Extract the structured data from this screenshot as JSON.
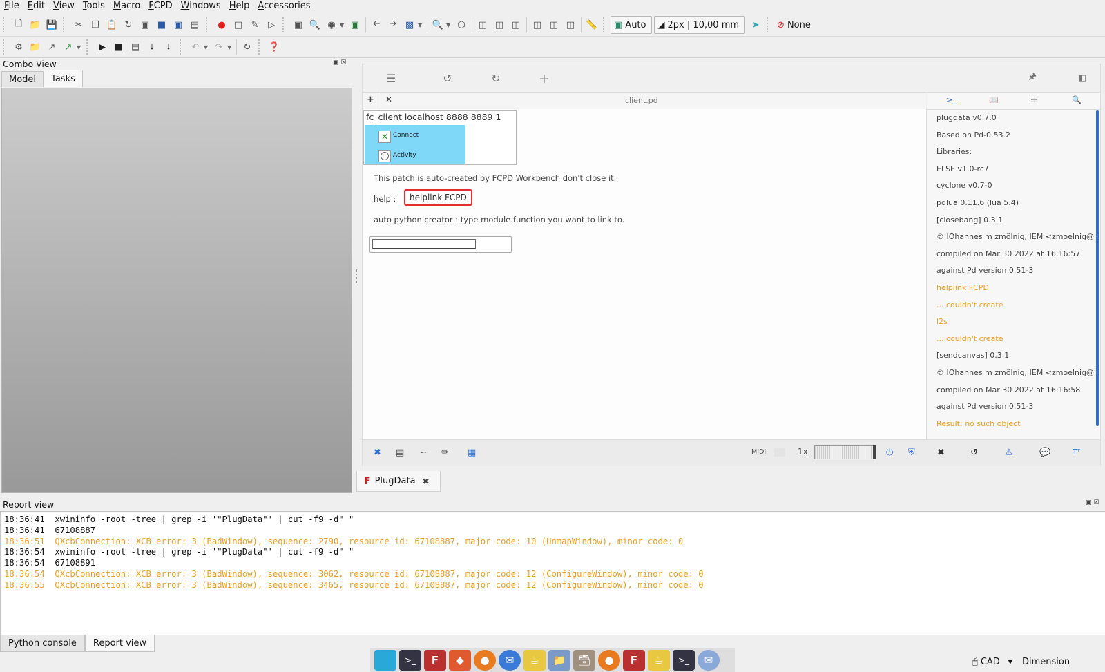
{
  "menubar": [
    "File",
    "Edit",
    "View",
    "Tools",
    "Macro",
    "FCPD",
    "Windows",
    "Help",
    "Accessories"
  ],
  "toolbar": {
    "draw_style_label": "Auto",
    "line_width_label": "2px | 10,00 mm",
    "snap_label": "None"
  },
  "combo_view": {
    "title": "Combo View",
    "tabs": [
      "Model",
      "Tasks"
    ],
    "active_tab": "Tasks"
  },
  "plugdata": {
    "canvas_tab": "client.pd",
    "fc_client_box": "fc_client localhost 8888 8889 1",
    "connect_label": "Connect",
    "activity_label": "Activity",
    "comment_auto": "This patch is auto-created by FCPD Workbench don't close it.",
    "help_label": "help :",
    "helplink_box": "helplink FCPD",
    "comment_python": "auto python creator : type module.function you want to link to.",
    "console_lines": [
      {
        "text": "plugdata v0.7.0",
        "warn": false
      },
      {
        "text": "Based on Pd-0.53.2",
        "warn": false
      },
      {
        "text": "Libraries:",
        "warn": false
      },
      {
        "text": "ELSE v1.0-rc7",
        "warn": false
      },
      {
        "text": "cyclone v0.7-0",
        "warn": false
      },
      {
        "text": "pdlua 0.11.6 (lua 5.4)",
        "warn": false
      },
      {
        "text": "[closebang] 0.3.1",
        "warn": false
      },
      {
        "text": "© IOhannes m zmölnig, IEM <zmoelnig@iem....",
        "warn": false
      },
      {
        "text": "compiled on Mar 30 2022 at 16:16:57",
        "warn": false
      },
      {
        "text": "against Pd version 0.51-3",
        "warn": false
      },
      {
        "text": "helplink FCPD",
        "warn": true
      },
      {
        "text": "... couldn't create",
        "warn": true
      },
      {
        "text": "l2s",
        "warn": true
      },
      {
        "text": "... couldn't create",
        "warn": true
      },
      {
        "text": "[sendcanvas] 0.3.1",
        "warn": false
      },
      {
        "text": "© IOhannes m zmölnig, IEM <zmoelnig@iem....",
        "warn": false
      },
      {
        "text": "compiled on Mar 30 2022 at 16:16:58",
        "warn": false
      },
      {
        "text": "against Pd version 0.51-3",
        "warn": false
      },
      {
        "text": "Result: no such object",
        "warn": true
      }
    ],
    "midi_label": "MIDI",
    "zoom_label": "1x",
    "window_tab": "PlugData"
  },
  "report_view": {
    "title": "Report view",
    "lines": [
      {
        "time": "18:36:41",
        "text": "xwininfo -root -tree | grep -i '\"PlugData\"' | cut -f9 -d\" \"",
        "warn": false
      },
      {
        "time": "18:36:41",
        "text": "67108887",
        "warn": false
      },
      {
        "time": "18:36:51",
        "text": "QXcbConnection: XCB error: 3 (BadWindow), sequence: 2790, resource id: 67108887, major code: 10 (UnmapWindow), minor code: 0",
        "warn": true
      },
      {
        "time": "18:36:54",
        "text": "xwininfo -root -tree | grep -i '\"PlugData\"' | cut -f9 -d\" \"",
        "warn": false
      },
      {
        "time": "18:36:54",
        "text": "67108891",
        "warn": false
      },
      {
        "time": "18:36:54",
        "text": "QXcbConnection: XCB error: 3 (BadWindow), sequence: 3062, resource id: 67108887, major code: 12 (ConfigureWindow), minor code: 0",
        "warn": true
      },
      {
        "time": "18:36:55",
        "text": "QXcbConnection: XCB error: 3 (BadWindow), sequence: 3465, resource id: 67108887, major code: 12 (ConfigureWindow), minor code: 0",
        "warn": true
      }
    ]
  },
  "bottom_tabs": [
    "Python console",
    "Report view"
  ],
  "active_bottom_tab": "Report view",
  "status": {
    "navigation_style": "CAD",
    "units": "Dimension"
  },
  "colors": {
    "warning": "#f0a020",
    "accent_blue": "#2d6fd2",
    "toggle_bg": "#7fd8f8",
    "helplink_border": "#e03030"
  }
}
